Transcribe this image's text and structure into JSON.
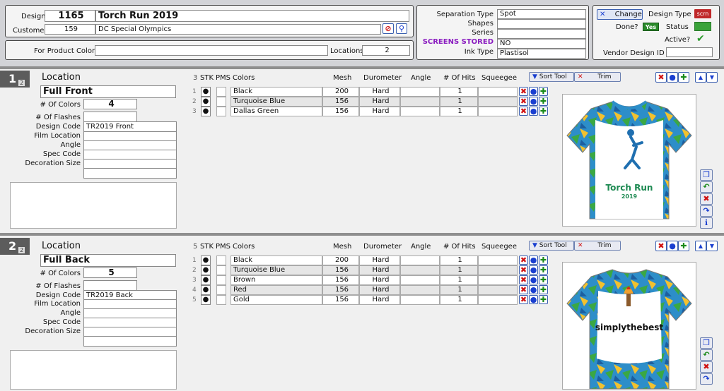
{
  "header": {
    "design_label": "Design",
    "design_number": "1165",
    "design_name": "Torch Run 2019",
    "customer_label": "Customer",
    "customer_number": "159",
    "customer_name": "DC Special Olympics",
    "product_colors_label": "For Product Colors",
    "product_colors_value": "",
    "locations_label": "Locations",
    "locations_value": "2"
  },
  "separation": {
    "type_label": "Separation Type",
    "type_value": "Spot",
    "shapes_label": "Shapes",
    "shapes_value": "",
    "series_label": "Series",
    "series_value": "",
    "screens_label": "SCREENS STORED",
    "screens_value": "NO",
    "ink_label": "Ink Type",
    "ink_value": "Plastisol"
  },
  "status": {
    "change_label": "Change",
    "design_type_label": "Design Type",
    "design_type_badge": "scrn",
    "done_label": "Done?",
    "done_value": "Yes",
    "status_label": "Status",
    "status_color": "#3aa33a",
    "active_label": "Active?",
    "vendor_label": "Vendor Design ID",
    "vendor_value": ""
  },
  "columns": {
    "stk": "STK",
    "pms": "PMS",
    "colors": "Colors",
    "mesh": "Mesh",
    "durometer": "Durometer",
    "angle": "Angle",
    "hits": "# Of Hits",
    "squeegee": "Squeegee",
    "sort_tool": "Sort Tool",
    "trim": "Trim"
  },
  "location_labels": {
    "location": "Location",
    "num_colors": "# Of Colors",
    "num_flashes": "# Of Flashes",
    "design_code": "Design Code",
    "film_location": "Film Location",
    "angle": "Angle",
    "spec_code": "Spec Code",
    "decoration_size": "Decoration Size"
  },
  "locations": [
    {
      "index": "1",
      "sub": "2",
      "name": "Full Front",
      "num_colors": "4",
      "color_count": "3",
      "design_code": "TR2019 Front",
      "image_title": "Torch Run",
      "image_year": "2019",
      "rows": [
        {
          "n": "1",
          "stk": "●",
          "color": "Black",
          "mesh": "200",
          "duro": "Hard",
          "angle": "",
          "hits": "1",
          "squeegee": ""
        },
        {
          "n": "2",
          "stk": "●",
          "color": "Turquoise Blue",
          "mesh": "156",
          "duro": "Hard",
          "angle": "",
          "hits": "1",
          "squeegee": ""
        },
        {
          "n": "3",
          "stk": "●",
          "color": "Dallas Green",
          "mesh": "156",
          "duro": "Hard",
          "angle": "",
          "hits": "1",
          "squeegee": ""
        }
      ]
    },
    {
      "index": "2",
      "sub": "2",
      "name": "Full Back",
      "num_colors": "5",
      "color_count": "5",
      "design_code": "TR2019 Back",
      "image_title": "simplythebest",
      "rows": [
        {
          "n": "1",
          "stk": "●",
          "color": "Black",
          "mesh": "200",
          "duro": "Hard",
          "angle": "",
          "hits": "1",
          "squeegee": ""
        },
        {
          "n": "2",
          "stk": "●",
          "color": "Turquoise Blue",
          "mesh": "156",
          "duro": "Hard",
          "angle": "",
          "hits": "1",
          "squeegee": ""
        },
        {
          "n": "3",
          "stk": "●",
          "color": "Brown",
          "mesh": "156",
          "duro": "Hard",
          "angle": "",
          "hits": "1",
          "squeegee": ""
        },
        {
          "n": "4",
          "stk": "●",
          "color": "Red",
          "mesh": "156",
          "duro": "Hard",
          "angle": "",
          "hits": "1",
          "squeegee": ""
        },
        {
          "n": "5",
          "stk": "●",
          "color": "Gold",
          "mesh": "156",
          "duro": "Hard",
          "angle": "",
          "hits": "1",
          "squeegee": ""
        }
      ]
    }
  ],
  "icons": [
    "cancel-icon",
    "search-icon",
    "pin-icon",
    "checkmark-icon",
    "delete-icon",
    "dot-icon",
    "add-icon",
    "arrow-up-icon",
    "arrow-down-icon",
    "copy-icon",
    "undo-icon",
    "forward-icon",
    "info-icon",
    "sort-down-icon"
  ]
}
